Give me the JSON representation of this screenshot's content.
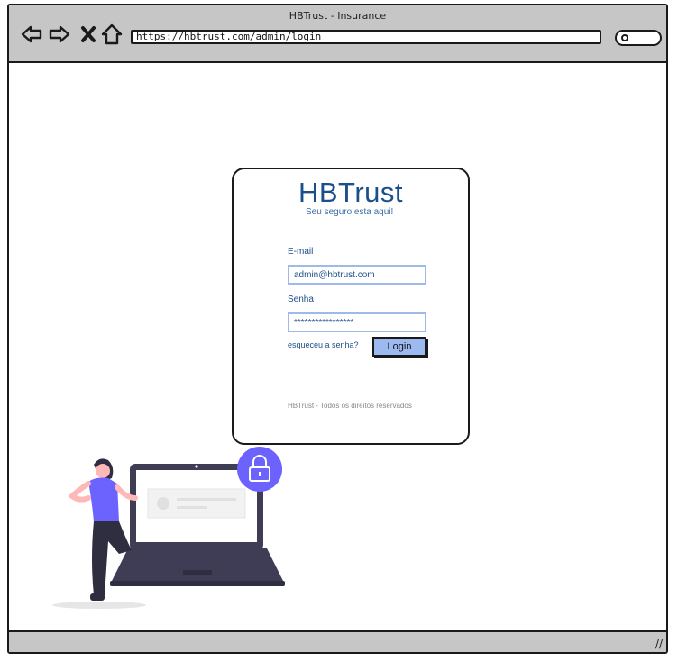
{
  "browser": {
    "title": "HBTrust - Insurance",
    "url": "https://hbtrust.com/admin/login"
  },
  "login": {
    "brand": "HBTrust",
    "tagline": "Seu seguro esta aqui!",
    "email_label": "E-mail",
    "email_value": "admin@hbtrust.com",
    "password_label": "Senha",
    "password_value": "*****************",
    "forgot_label": "esqueceu a senha?",
    "login_button": "Login",
    "footer": "HBTrust - Todos os direitos reservados"
  },
  "colors": {
    "brand": "#1b4f8a",
    "button": "#9dbaf0",
    "field_border": "#9fb9e8",
    "accent_purple": "#6c63ff"
  },
  "icons": [
    "back-icon",
    "forward-icon",
    "close-icon",
    "home-icon",
    "search-icon",
    "lock-icon",
    "resize-icon"
  ]
}
